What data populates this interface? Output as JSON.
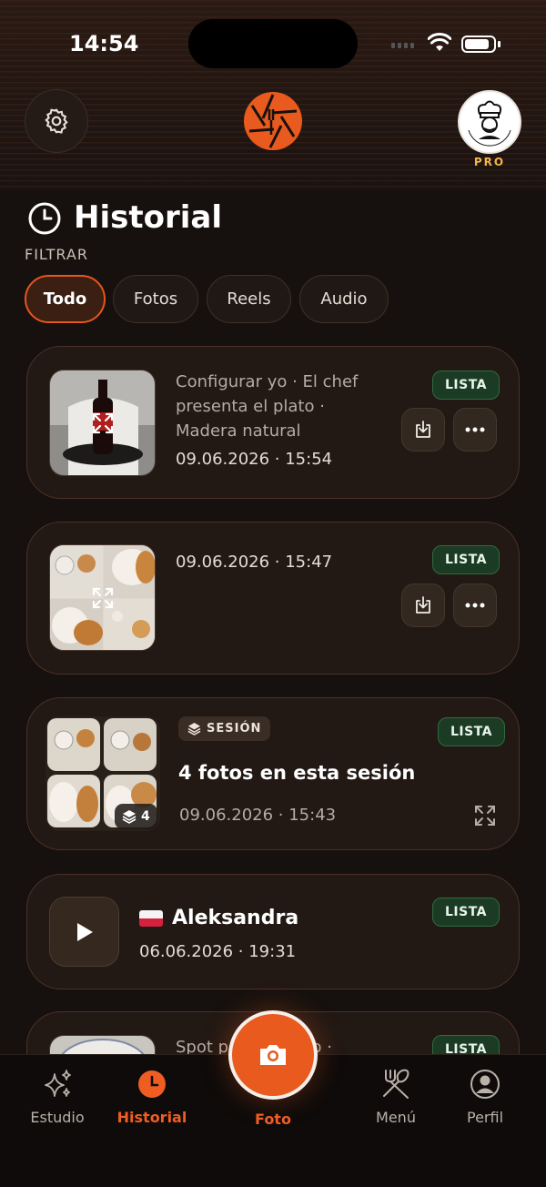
{
  "status": {
    "time": "14:54"
  },
  "header": {
    "pro_label": "PRO",
    "avatar_text": "RESTAURANT LOGO"
  },
  "page": {
    "title": "Historial",
    "filter_label": "FILTRAR"
  },
  "filters": [
    {
      "label": "Todo",
      "active": true
    },
    {
      "label": "Fotos",
      "active": false
    },
    {
      "label": "Reels",
      "active": false
    },
    {
      "label": "Audio",
      "active": false
    }
  ],
  "items": [
    {
      "type": "photo",
      "description": "Configurar yo · El chef presenta el plato · Madera natural",
      "date": "09.06.2026 · 15:54",
      "status": "LISTA"
    },
    {
      "type": "photo",
      "description": "",
      "date": "09.06.2026 · 15:47",
      "status": "LISTA"
    },
    {
      "type": "session",
      "badge": "SESIÓN",
      "title": "4 fotos en esta sesión",
      "date": "09.06.2026 · 15:43",
      "status": "LISTA",
      "count": "4"
    },
    {
      "type": "audio",
      "title": "Aleksandra",
      "date": "06.06.2026 · 19:31",
      "status": "LISTA"
    },
    {
      "type": "photo",
      "description": "Spot p… del plato ·",
      "status": "LISTA"
    }
  ],
  "tabs": [
    {
      "label": "Estudio",
      "icon": "sparkles-icon"
    },
    {
      "label": "Historial",
      "icon": "clock-icon",
      "active": true
    },
    {
      "label": "Foto",
      "icon": "camera-icon"
    },
    {
      "label": "Menú",
      "icon": "utensils-icon"
    },
    {
      "label": "Perfil",
      "icon": "user-icon"
    }
  ],
  "colors": {
    "accent": "#e85a1e",
    "background": "#16110e",
    "card": "#221814",
    "badge_green": "#1c3b25",
    "pro": "#f2b34a"
  }
}
